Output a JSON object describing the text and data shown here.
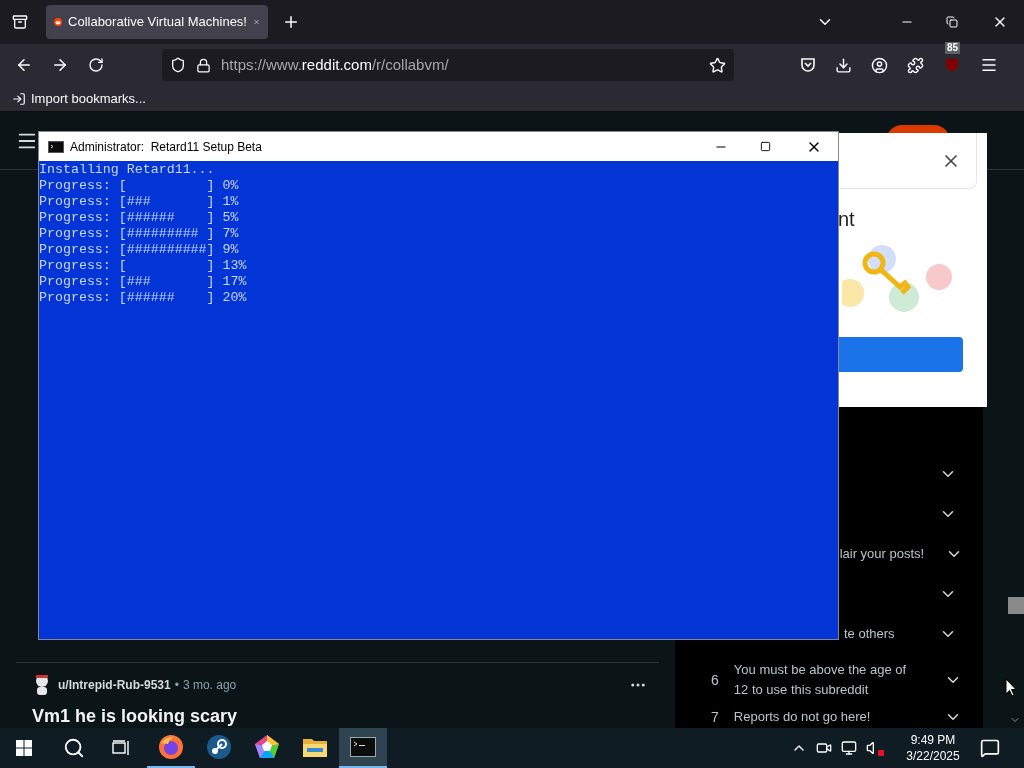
{
  "browser": {
    "tabs": [
      {
        "title": "Collaborative Virtual Machines!",
        "selected": true
      }
    ],
    "url": [
      {
        "kind": "dim",
        "text": "https://www."
      },
      {
        "kind": "bright",
        "text": "reddit.com"
      },
      {
        "kind": "dim",
        "text": "/r/collabvm/"
      }
    ],
    "extension_badge": "85",
    "bookmarks": [
      {
        "label": "Import bookmarks..."
      }
    ]
  },
  "page": {
    "post": {
      "author": "u/Intrepid-Rub-9531",
      "separator": "•",
      "age": "3 mo. ago",
      "title": "Vm1 he is looking scary"
    },
    "rules": [
      {
        "expanded": false
      },
      {
        "expanded": false
      },
      {
        "text": "lair your posts!",
        "expanded": false
      },
      {
        "expanded": false
      },
      {
        "text": "te others",
        "expanded": false
      },
      {
        "number": "6",
        "text": "You must be above the age of 12 to use this subreddit",
        "expanded": false
      },
      {
        "number": "7",
        "text": "Reports do not go here!",
        "expanded": false
      }
    ]
  },
  "popup": {
    "heading": "nt"
  },
  "console": {
    "title": "Administrator:  Retard11 Setup Beta",
    "lines": [
      "Installing Retard11...",
      "Progress: [          ] 0%",
      "Progress: [###       ] 1%",
      "Progress: [######    ] 5%",
      "Progress: [######### ] 7%",
      "Progress: [##########] 9%",
      "Progress: [          ] 13%",
      "Progress: [###       ] 17%",
      "Progress: [######    ] 20%"
    ]
  },
  "taskbar": {
    "apps": [
      {
        "kind": "browser",
        "running": true,
        "selected": false
      },
      {
        "kind": "store",
        "running": false,
        "selected": false
      },
      {
        "kind": "pentagon",
        "running": false,
        "selected": false
      },
      {
        "kind": "folder",
        "running": false,
        "selected": false
      },
      {
        "kind": "terminal",
        "running": true,
        "selected": true
      }
    ],
    "volume_muted": true,
    "time": "9:49 PM",
    "date": "3/22/2025"
  }
}
